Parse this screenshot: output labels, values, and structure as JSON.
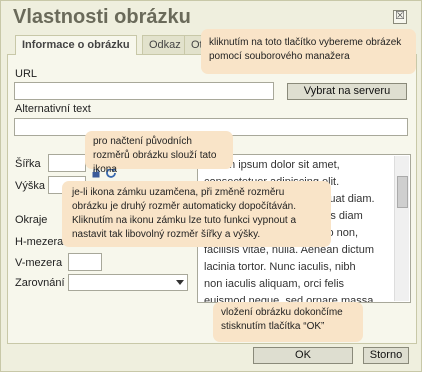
{
  "dialog": {
    "title": "Vlastnosti obrázku",
    "close_label": "☒"
  },
  "tabs": [
    {
      "label": "Informace o obrázku",
      "active": true
    },
    {
      "label": "Odkaz",
      "active": false
    },
    {
      "label": "Ot",
      "active": false
    }
  ],
  "form": {
    "url_label": "URL",
    "url_value": "",
    "browse_button": "Vybrat na serveru",
    "alt_label": "Alternativní text",
    "alt_value": "",
    "width_label": "Šířka",
    "height_label": "Výška",
    "border_label": "Okraje",
    "hspace_label": "H-mezera",
    "vspace_label": "V-mezera",
    "align_label": "Zarovnání",
    "align_value": ""
  },
  "preview": {
    "text_lines": [
      "Lorem ipsum dolor sit amet,",
      "consectetuer adipiscing elit.",
      "Maecenas feugiat consequat diam.",
      "Maecenas metus. Vivamus diam",
      "purus, cursus a, commodo non,",
      "facilisis vitae, nulla. Aenean dictum",
      "lacinia tortor. Nunc iaculis, nibh",
      "non iaculis aliquam, orci felis",
      "euismod neque, sed ornare massa"
    ]
  },
  "tooltips": {
    "browse_tip": "kliknutím na toto tlačítko vybereme obrázek pomocí souborového manažera",
    "reset_tip": "pro načtení původních rozměrů obrázku slouží tato ikona",
    "lock_tip": "je-li ikona zámku uzamčena, při změně rozměru obrázku je druhý rozměr automaticky dopočítáván. Kliknutím na ikonu zámku lze tuto funkci vypnout a nastavit tak libovolný rozměr šířky a výšky.",
    "ok_tip": "vložení obrázku dokončíme stisknutím tlačítka “OK”"
  },
  "footer": {
    "ok_button": "OK",
    "cancel_button": "Storno"
  },
  "colors": {
    "background": "#efefde",
    "tooltip": "#f9e4c8",
    "title": "#6a6a5a"
  },
  "icons": {
    "lock": "lock-icon",
    "reset": "refresh-icon",
    "close": "close-icon"
  }
}
